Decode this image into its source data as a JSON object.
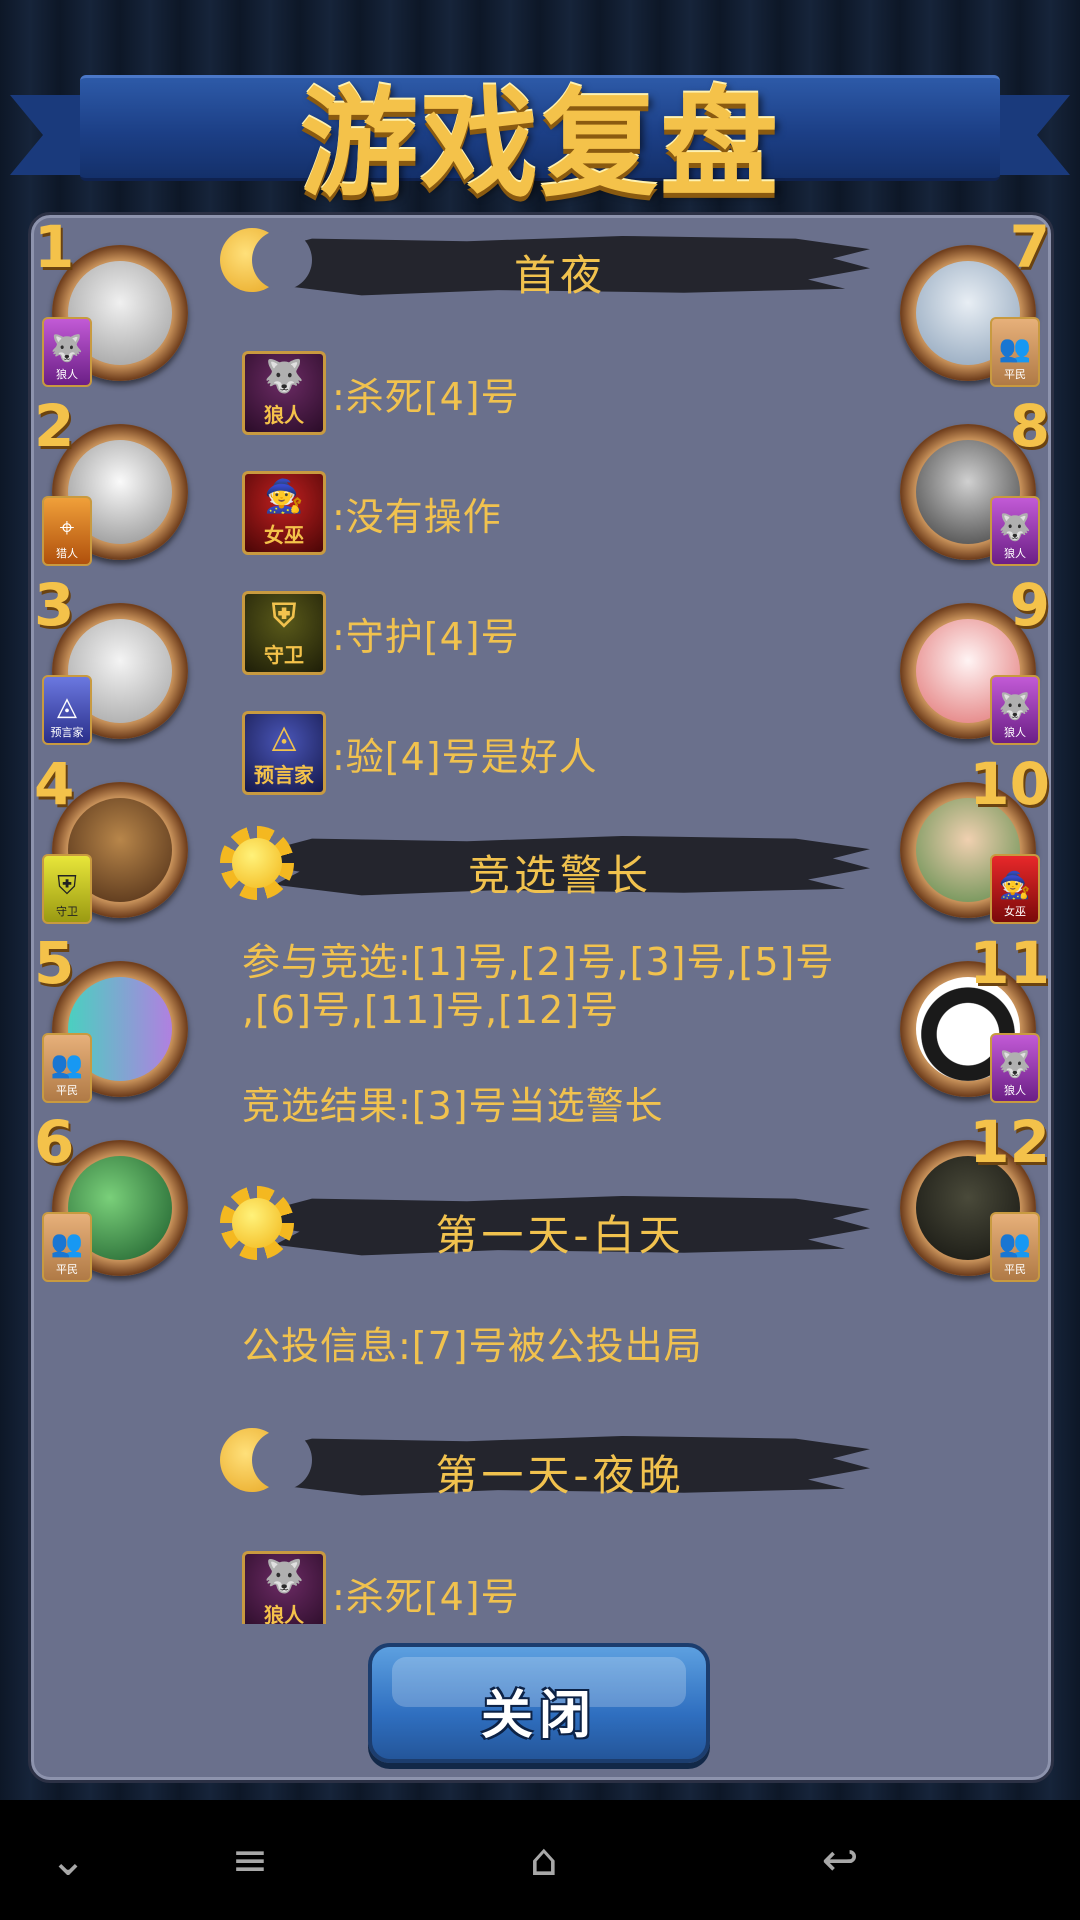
{
  "title": "游戏复盘",
  "players_left": [
    {
      "num": "1",
      "badge": "狼人",
      "badge_type": "wolf",
      "avatar_color": "#d8d8d8"
    },
    {
      "num": "2",
      "badge": "猎人",
      "badge_type": "hunter",
      "avatar_color": "#e8e8e8"
    },
    {
      "num": "3",
      "badge": "预言家",
      "badge_type": "seer",
      "avatar_color": "#cfcfcf"
    },
    {
      "num": "4",
      "badge": "守卫",
      "badge_type": "guard",
      "avatar_color": "#7a5a3a"
    },
    {
      "num": "5",
      "badge": "平民",
      "badge_type": "civ",
      "avatar_color": "#8a6ab0"
    },
    {
      "num": "6",
      "badge": "平民",
      "badge_type": "civ",
      "avatar_color": "#3a7a3a"
    }
  ],
  "players_right": [
    {
      "num": "7",
      "badge": "平民",
      "badge_type": "civ",
      "avatar_color": "#b8c8d8"
    },
    {
      "num": "8",
      "badge": "狼人",
      "badge_type": "wolf",
      "avatar_color": "#9a9a9a"
    },
    {
      "num": "9",
      "badge": "狼人",
      "badge_type": "wolf",
      "avatar_color": "#f0e8e8"
    },
    {
      "num": "10",
      "badge": "女巫",
      "badge_type": "witch",
      "avatar_color": "#a08060"
    },
    {
      "num": "11",
      "badge": "狼人",
      "badge_type": "wolf",
      "avatar_color": "#f4f4f4"
    },
    {
      "num": "12",
      "badge": "平民",
      "badge_type": "civ",
      "avatar_color": "#3a3a2a"
    }
  ],
  "sections": {
    "night1": {
      "title": "首夜",
      "actions": [
        {
          "role": "狼人",
          "text": ":杀死[4]号"
        },
        {
          "role": "女巫",
          "text": ":没有操作"
        },
        {
          "role": "守卫",
          "text": ":守护[4]号"
        },
        {
          "role": "预言家",
          "text": ":验[4]号是好人"
        }
      ]
    },
    "sheriff": {
      "title": "竞选警长",
      "candidates_line1": "参与竞选:[1]号,[2]号,[3]号,[5]号",
      "candidates_line2": ",[6]号,[11]号,[12]号",
      "result": "竞选结果:[3]号当选警长"
    },
    "day1": {
      "title": "第一天-白天",
      "vote": "公投信息:[7]号被公投出局"
    },
    "night2": {
      "title": "第一天-夜晚",
      "actions": [
        {
          "role": "狼人",
          "text": ":杀死[4]号"
        }
      ]
    }
  },
  "close_button": "关闭",
  "nav": {
    "down": "⌄",
    "menu": "≡",
    "home": "⌂",
    "back": "↩"
  }
}
